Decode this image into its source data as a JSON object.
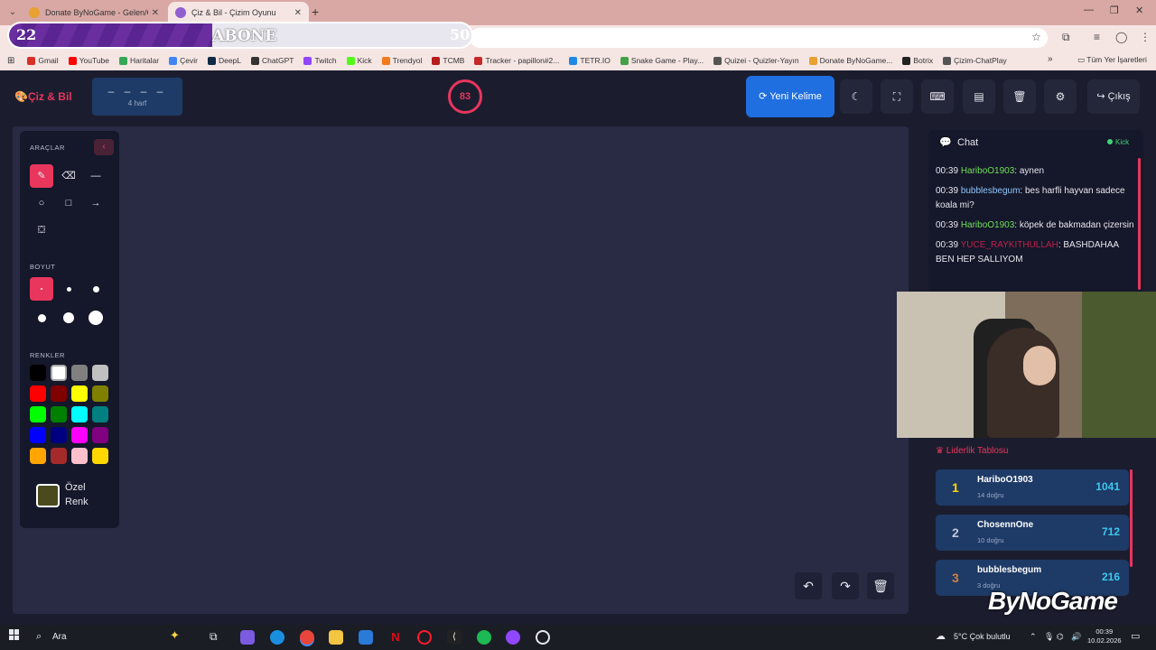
{
  "browser": {
    "tabs": [
      {
        "label": "Donate ByNoGame - Gelen/Gi:",
        "color": "#e8a030"
      },
      {
        "label": "Çiz & Bil - Çizim Oyunu",
        "color": "#9060d0"
      }
    ],
    "bookmarks": [
      {
        "label": "Gmail",
        "color": "#d93025"
      },
      {
        "label": "YouTube",
        "color": "#ff0000"
      },
      {
        "label": "Haritalar",
        "color": "#34a853"
      },
      {
        "label": "Çevir",
        "color": "#4285f4"
      },
      {
        "label": "DeepL",
        "color": "#0f2b46"
      },
      {
        "label": "ChatGPT",
        "color": "#333333"
      },
      {
        "label": "Twitch",
        "color": "#9146ff"
      },
      {
        "label": "Kick",
        "color": "#53fc18"
      },
      {
        "label": "Trendyol",
        "color": "#f27a1a"
      },
      {
        "label": "TCMB",
        "color": "#b71c1c"
      },
      {
        "label": "Tracker - papillon#2...",
        "color": "#c62828"
      },
      {
        "label": "TETR.IO",
        "color": "#1e88e5"
      },
      {
        "label": "Snake Game - Play...",
        "color": "#43a047"
      },
      {
        "label": "Quizei - Quizler-Yayın",
        "color": "#555555"
      },
      {
        "label": "Donate ByNoGame...",
        "color": "#e8a030"
      },
      {
        "label": "Botrix",
        "color": "#222222"
      },
      {
        "label": "Çizim-ChatPlay",
        "color": "#555555"
      }
    ],
    "all_bookmarks": "Tüm Yer İşaretleri"
  },
  "subscription": {
    "current": "22",
    "label": "ABONE",
    "goal": "50",
    "progress": 0.44
  },
  "app": {
    "logo": "Çiz & Bil",
    "word_mask": "– – – –",
    "word_hint": "4 harf",
    "timer": "83",
    "new_word_label": "Yeni Kelime",
    "logout_label": "Çıkış"
  },
  "tools": {
    "tools_title": "ARAÇLAR",
    "size_title": "BOYUT",
    "colors_title": "RENKLER",
    "custom_color_label": "Özel Renk",
    "custom_color": "#4a4a1e",
    "colors": [
      "#000000",
      "#ffffff",
      "#808080",
      "#c0c0c0",
      "#ff0000",
      "#800000",
      "#ffff00",
      "#808000",
      "#00ff00",
      "#008000",
      "#00ffff",
      "#008080",
      "#0000ff",
      "#000080",
      "#ff00ff",
      "#800080",
      "#ffa500",
      "#a52a2a",
      "#ffc0cb",
      "#ffd700"
    ]
  },
  "chat": {
    "title": "Chat",
    "platform": "Kick",
    "messages": [
      {
        "time": "00:39",
        "user": "HariboO1903",
        "user_color": "#6fe05a",
        "text": ": aynen"
      },
      {
        "time": "00:39",
        "user": "bubblesbegum",
        "user_color": "#8ec8ff",
        "text": ": bes harfli hayvan sadece koala mi?"
      },
      {
        "time": "00:39",
        "user": "HariboO1903",
        "user_color": "#6fe05a",
        "text": ": köpek de bakmadan çizersin"
      },
      {
        "time": "00:39",
        "user": "YUCE_RAYKITHULLAH",
        "user_color": "#c0204a",
        "text": ": BASHDAHAA BEN HEP SALLIYOM"
      }
    ]
  },
  "leaderboard": {
    "title": "Liderlik Tablosu",
    "entries": [
      {
        "rank": "1",
        "name": "HariboO1903",
        "sub": "14 doğru",
        "score": "1041",
        "rank_color": "#ffd700"
      },
      {
        "rank": "2",
        "name": "ChosennOne",
        "sub": "10 doğru",
        "score": "712",
        "rank_color": "#c0c8d8"
      },
      {
        "rank": "3",
        "name": "bubblesbegum",
        "sub": "3 doğru",
        "score": "216",
        "rank_color": "#d08040"
      }
    ]
  },
  "watermark": "ByNoGame",
  "taskbar": {
    "search": "Ara",
    "weather": "5°C  Çok bulutlu",
    "time": "00:39",
    "date": "10.02.2026"
  },
  "colors": {
    "accent": "#e8365d",
    "primary": "#1f6fe0"
  }
}
